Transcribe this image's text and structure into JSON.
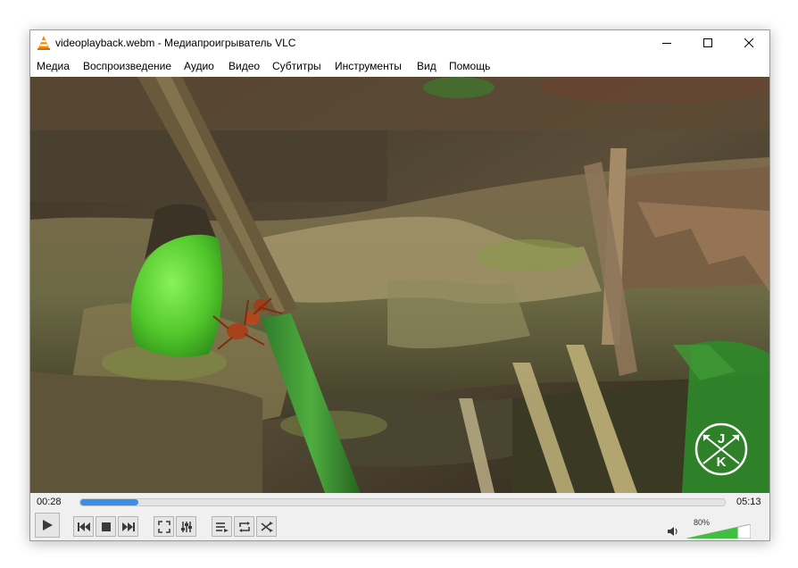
{
  "window": {
    "title": "videoplayback.webm - Медиапроигрыватель VLC",
    "app_icon": "vlc-cone-icon",
    "controls": [
      "minimize-icon",
      "maximize-icon",
      "close-icon"
    ]
  },
  "menu": {
    "items": [
      "Медиа",
      "Воспроизведение",
      "Аудио",
      "Видео",
      "Субтитры",
      "Инструменты",
      "Вид",
      "Помощь"
    ]
  },
  "video": {
    "watermark_letters": [
      "J",
      "K"
    ],
    "watermark_icon": "crossed-arrows-icon"
  },
  "playback": {
    "elapsed": "00:28",
    "total": "05:13",
    "progress_fraction": 0.09,
    "buttons": [
      "play-icon",
      "previous-icon",
      "stop-icon",
      "next-icon",
      "fullscreen-icon",
      "extended-settings-icon",
      "playlist-icon",
      "loop-icon",
      "shuffle-icon"
    ]
  },
  "volume": {
    "label": "80%",
    "level_fraction": 0.8,
    "icon": "speaker-icon"
  },
  "colors": {
    "accent": "#3a8ee6",
    "volume_fill": "#3fbf3f",
    "control_bg": "#f0f0f0"
  }
}
